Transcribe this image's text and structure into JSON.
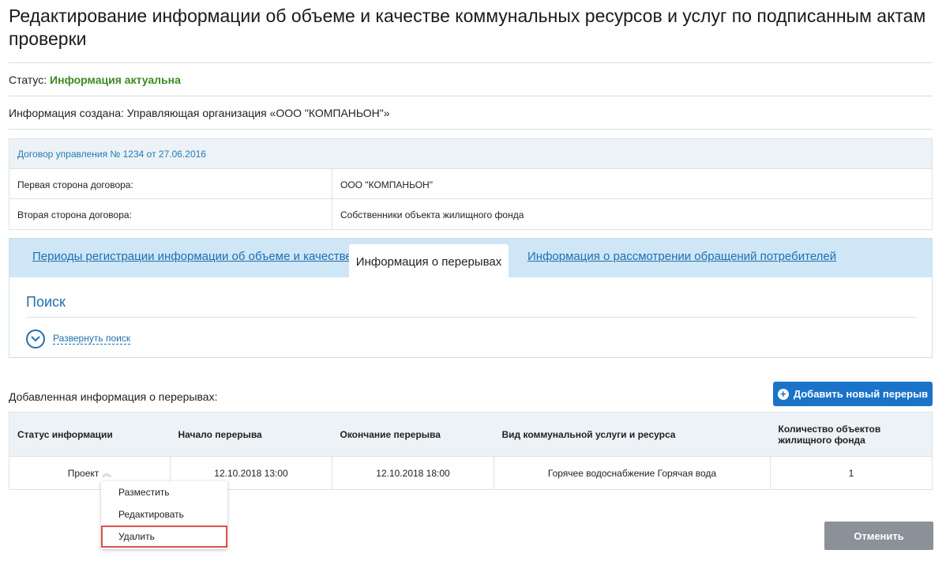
{
  "page": {
    "title": "Редактирование информации об объеме и качестве коммунальных ресурсов и услуг по подписанным актам проверки"
  },
  "status": {
    "label": "Статус:",
    "value": "Информация актуальна",
    "color": "#3a8a22"
  },
  "created_by": {
    "text": "Информация создана: Управляющая организация «ООО \"КОМПАНЬОН\"»"
  },
  "contract": {
    "header": "Договор управления № 1234 от 27.06.2016",
    "rows": [
      {
        "label": "Первая сторона договора:",
        "value": "ООО \"КОМПАНЬОН\""
      },
      {
        "label": "Вторая сторона договора:",
        "value": "Собственники объекта жилищного фонда"
      }
    ]
  },
  "tabs": [
    {
      "label": "Периоды регистрации информации об объеме и качестве",
      "active": false
    },
    {
      "label": "Информация о перерывах",
      "active": true
    },
    {
      "label": "Информация о рассмотрении обращений потребителей",
      "active": false
    }
  ],
  "search": {
    "title": "Поиск",
    "expand_label": "Развернуть поиск",
    "icon": "chevron-down-circle-icon"
  },
  "breaks": {
    "section_label": "Добавленная информация о перерывах:",
    "add_button": "Добавить новый перерыв",
    "columns": [
      "Статус информации",
      "Начало перерыва",
      "Окончание перерыва",
      "Вид коммунальной услуги и ресурса",
      "Количество объектов жилищного фонда"
    ],
    "rows": [
      {
        "status": "Проект",
        "start": "12.10.2018 13:00",
        "end": "12.10.2018 18:00",
        "service": "Горячее водоснабжение Горячая вода",
        "count": "1"
      }
    ]
  },
  "context_menu": {
    "items": [
      {
        "label": "Разместить"
      },
      {
        "label": "Редактировать"
      },
      {
        "label": "Удалить",
        "highlighted": true
      }
    ],
    "highlight_color": "#d9534f"
  },
  "footer": {
    "cancel_button": "Отменить"
  },
  "colors": {
    "accent": "#1a73c8",
    "link": "#1f6fae",
    "tabs_bg": "#cfe6f7",
    "cancel_bg": "#8a9198"
  }
}
